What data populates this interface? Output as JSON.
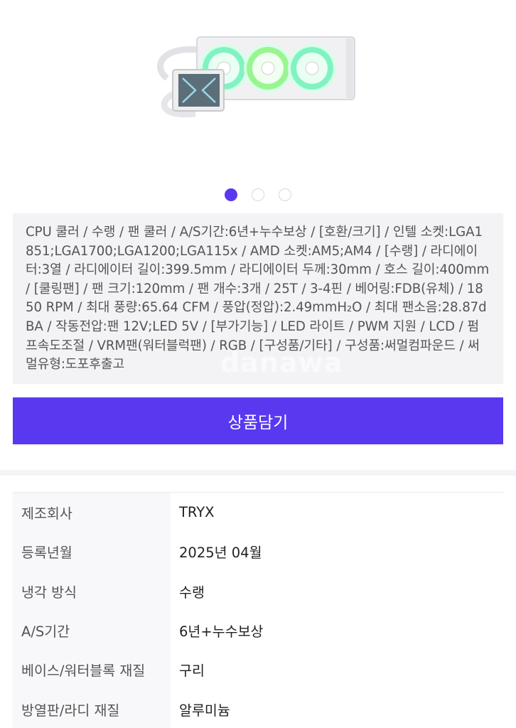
{
  "pagination": {
    "total": 3,
    "active_index": 0
  },
  "spec_text": "CPU 쿨러 / 수랭 / 팬 쿨러 / A/S기간:6년+누수보상 / [호환/크기] / 인텔 소켓:LGA1851;LGA1700;LGA1200;LGA115x / AMD 소켓:AM5;AM4 / [수랭] / 라디에이터:3열 / 라디에이터 길이:399.5mm / 라디에이터 두께:30mm / 호스 길이:400mm / [쿨링팬] / 팬 크기:120mm / 팬 개수:3개 / 25T / 3-4핀 / 베어링:FDB(유체) / 1850 RPM / 최대 풍량:65.64 CFM / 풍압(정압):2.49mmH₂O / 최대 팬소음:28.87dBA / 작동전압:팬 12V;LED 5V / [부가기능] / LED 라이트 / PWM 지원 / LCD / 펌프속도조절 / VRM팬(워터블럭팬) / RGB / [구성품/기타] / 구성품:써멀컴파운드 / 써멀유형:도포후출고",
  "watermark": "danawa",
  "cart_button_label": "상품담기",
  "info_rows": [
    {
      "label": "제조회사",
      "value": "TRYX"
    },
    {
      "label": "등록년월",
      "value": "2025년 04월"
    },
    {
      "label": "냉각 방식",
      "value": "수랭"
    },
    {
      "label": "A/S기간",
      "value": "6년+누수보상"
    },
    {
      "label": "베이스/워터블록 재질",
      "value": "구리"
    },
    {
      "label": "방열판/라디 재질",
      "value": "알루미늄"
    }
  ],
  "colors": {
    "accent": "#5a38f0",
    "spec_bg": "#f3f2f5",
    "label_bg": "#f8f7f9"
  }
}
